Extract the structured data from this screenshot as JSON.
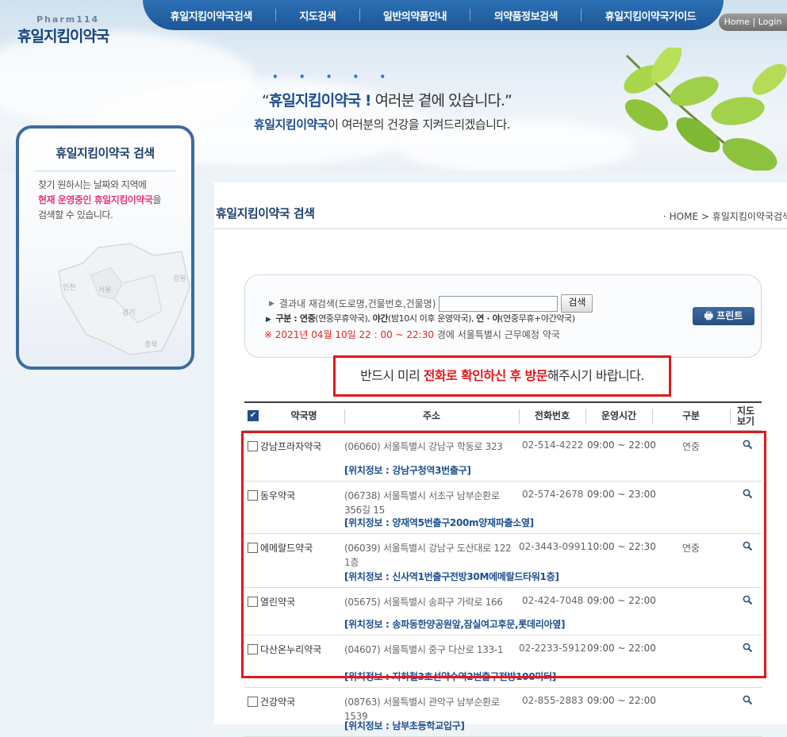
{
  "header": {
    "logo_en": "Pharm114",
    "logo_kr": "휴일지킴이약국",
    "nav": [
      "휴일지킴이약국검색",
      "지도검색",
      "일반의약품안내",
      "의약품정보검색",
      "휴일지킴이약국가이드"
    ],
    "home_login": "Home | Login",
    "slogan1_open": "“",
    "slogan1_strong": "휴일지킴이약국 !",
    "slogan1_rest": " 여러분 곁에 있습니다.”",
    "slogan2_strong": "휴일지킴이약국",
    "slogan2_rest": "이 여러분의 건강을 지켜드리겠습니다.",
    "dots": "• • • • •"
  },
  "sidebar": {
    "title": "휴일지킴이약국 검색",
    "line1": "찾기 원하시는 날짜와 지역에",
    "line2_hl": "현재 운영중인 휴일지킴이약국",
    "line2_rest": "을",
    "line3": "검색할 수 있습니다.",
    "map_labels": [
      "인천",
      "서울",
      "경기",
      "강원",
      "충북"
    ]
  },
  "main": {
    "page_title": "휴일지킴이약국 검색",
    "breadcrumb": "· HOME > 휴일지킴이약국검색",
    "search": {
      "label": "결과내 재검색(도로명,건물번호,건물명)",
      "input_value": "",
      "button": "검색",
      "legend_prefix": "구분 : ",
      "legend_1b": "연중",
      "legend_1": "(연중무휴약국), ",
      "legend_2b": "야간",
      "legend_2": "(밤10시 이후 운영약국), ",
      "legend_3b": "연 · 야",
      "legend_3": "(연중무휴+야간약국)",
      "date_red": "※ 2021년 04월 10일 22 : 00 ~ 22:30",
      "date_rest": " 경에  서울특별시      근무예정 약국",
      "print": "프린트"
    },
    "notice": {
      "pre": "반드시 미리 ",
      "red1": "전화로 확인하신 후 방문",
      "post": "해주시기 바랍니다."
    },
    "table": {
      "headers": [
        "약국명",
        "주소",
        "전화번호",
        "운영시간",
        "구분",
        "지도\n보기"
      ],
      "rows": [
        {
          "name": "강남프라자약국",
          "addr": "(06060) 서울특별시 강남구 학동로 323",
          "tel": "02-514-4222",
          "hours": "09:00 ~ 22:00",
          "type": "연중",
          "loc": "[위치정보 : 강남구청역3번출구]"
        },
        {
          "name": "동우약국",
          "addr": "(06738) 서울특별시 서초구 남부순환로 356길 15",
          "tel": "02-574-2678",
          "hours": "09:00 ~ 23:00",
          "type": "",
          "loc": "[위치정보 : 양재역5번출구200m양재파출소옆]"
        },
        {
          "name": "에메랄드약국",
          "addr": "(06039) 서울특별시 강남구 도산대로 122 1층",
          "tel": "02-3443-0991",
          "hours": "10:00 ~ 22:30",
          "type": "연중",
          "loc": "[위치정보 : 신사역1번출구전방30M에메랄드타워1층]"
        },
        {
          "name": "열린약국",
          "addr": "(05675) 서울특별시 송파구 가락로 166",
          "tel": "02-424-7048",
          "hours": "09:00 ~ 22:00",
          "type": "",
          "loc": "[위치정보 : 송파동한양공원앞,잠실여고후문,롯데리아옆]"
        },
        {
          "name": "다산온누리약국",
          "addr": "(04607) 서울특별시 중구 다산로 133-1",
          "tel": "02-2233-5912",
          "hours": "09:00 ~ 22:00",
          "type": "",
          "loc": "[위치정보 : 지하철3호선약수역2번출구전방100미터]"
        },
        {
          "name": "건강약국",
          "addr": "(08763) 서울특별시 관악구 남부순환로 1539",
          "tel": "02-855-2883",
          "hours": "09:00 ~ 22:00",
          "type": "",
          "loc": "[위치정보 : 남부초등학교입구]"
        }
      ]
    }
  }
}
